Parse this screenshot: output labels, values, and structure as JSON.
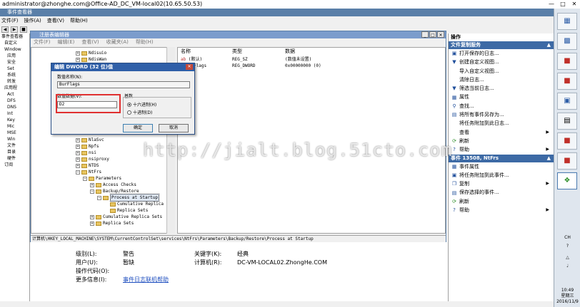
{
  "session": {
    "title": "administrator@zhonghe.com@Office-AD_DC_VM-local02(10.65.50.53)"
  },
  "event_viewer": {
    "title": "事件查看器",
    "menu": [
      "文件(F)",
      "操作(A)",
      "查看(V)",
      "帮助(H)"
    ],
    "tree": [
      "事件查看器",
      "自定义",
      "Window",
      "应用",
      "安全",
      "Set",
      "系统",
      "转发",
      "应用程",
      "Act",
      "DFS",
      "DNS",
      "Int",
      "Key",
      "Mic",
      "MSE",
      "Win",
      "文件",
      "目录",
      "硬件",
      "订阅"
    ],
    "details": {
      "level_label": "级别(L):",
      "level_value": "警告",
      "keywords_label": "关键字(K):",
      "keywords_value": "经典",
      "user_label": "用户(U):",
      "user_value": "暂缺",
      "computer_label": "计算机(R):",
      "computer_value": "DC-VM-LOCAL02.ZhongHe.COM",
      "opcode_label": "操作代码(O):",
      "more_info_label": "更多信息(I):",
      "more_info_link": "事件日志联机帮助"
    }
  },
  "actions": {
    "header": "操作",
    "group1": "文件复制服务",
    "items1": [
      "打开保存的日志...",
      "创建自定义视图...",
      "导入自定义视图...",
      "清除日志...",
      "筛选当前日志...",
      "属性",
      "查找...",
      "将所有事件另存为...",
      "将任务附加到此日志...",
      "查看",
      "刷新",
      "帮助"
    ],
    "group2": "事件 13508, NtFrs",
    "items2": [
      "事件属性",
      "将任务附加到此事件...",
      "复制",
      "保存选择的事件...",
      "刷新",
      "帮助"
    ]
  },
  "registry": {
    "title": "注册表编辑器",
    "menu": [
      "文件(F)",
      "编辑(E)",
      "查看(V)",
      "收藏夹(A)",
      "帮助(H)"
    ],
    "tree_top": [
      "Ndisuio",
      "NdisWan"
    ],
    "tree": [
      "NlaSvc",
      "Npfs",
      "nsi",
      "nsiproxy",
      "NTDS",
      "NtFrs",
      "Parameters",
      "Access Checks",
      "Backup/Restore",
      "Process at Startup",
      "Cumulative Replica",
      "Replica Sets",
      "Cumulative Replica Sets",
      "Replica Sets"
    ],
    "columns": {
      "name": "名称",
      "type": "类型",
      "data": "数据"
    },
    "values": [
      {
        "name": "(默认)",
        "type": "REG_SZ",
        "data": "(数值未设置)"
      },
      {
        "name": "BurFlags",
        "type": "REG_DWORD",
        "data": "0x00000000 (0)"
      }
    ],
    "status": "计算机\\HKEY_LOCAL_MACHINE\\SYSTEM\\CurrentControlSet\\services\\NtFrs\\Parameters\\Backup/Restore\\Process at Startup"
  },
  "dialog": {
    "title": "编辑 DWORD (32 位)值",
    "name_label": "数值名称(N):",
    "name_value": "BurFlags",
    "data_label": "数值数据(V):",
    "data_value": "D2",
    "base_label": "基数",
    "hex_label": "十六进制(H)",
    "dec_label": "十进制(D)",
    "ok": "确定",
    "cancel": "取消"
  },
  "taskbar": {
    "lang": "CH",
    "time": "10:49",
    "weekday": "星期三",
    "date": "2016/11/9"
  },
  "watermark": "http://jialt.blog.51cto.com"
}
